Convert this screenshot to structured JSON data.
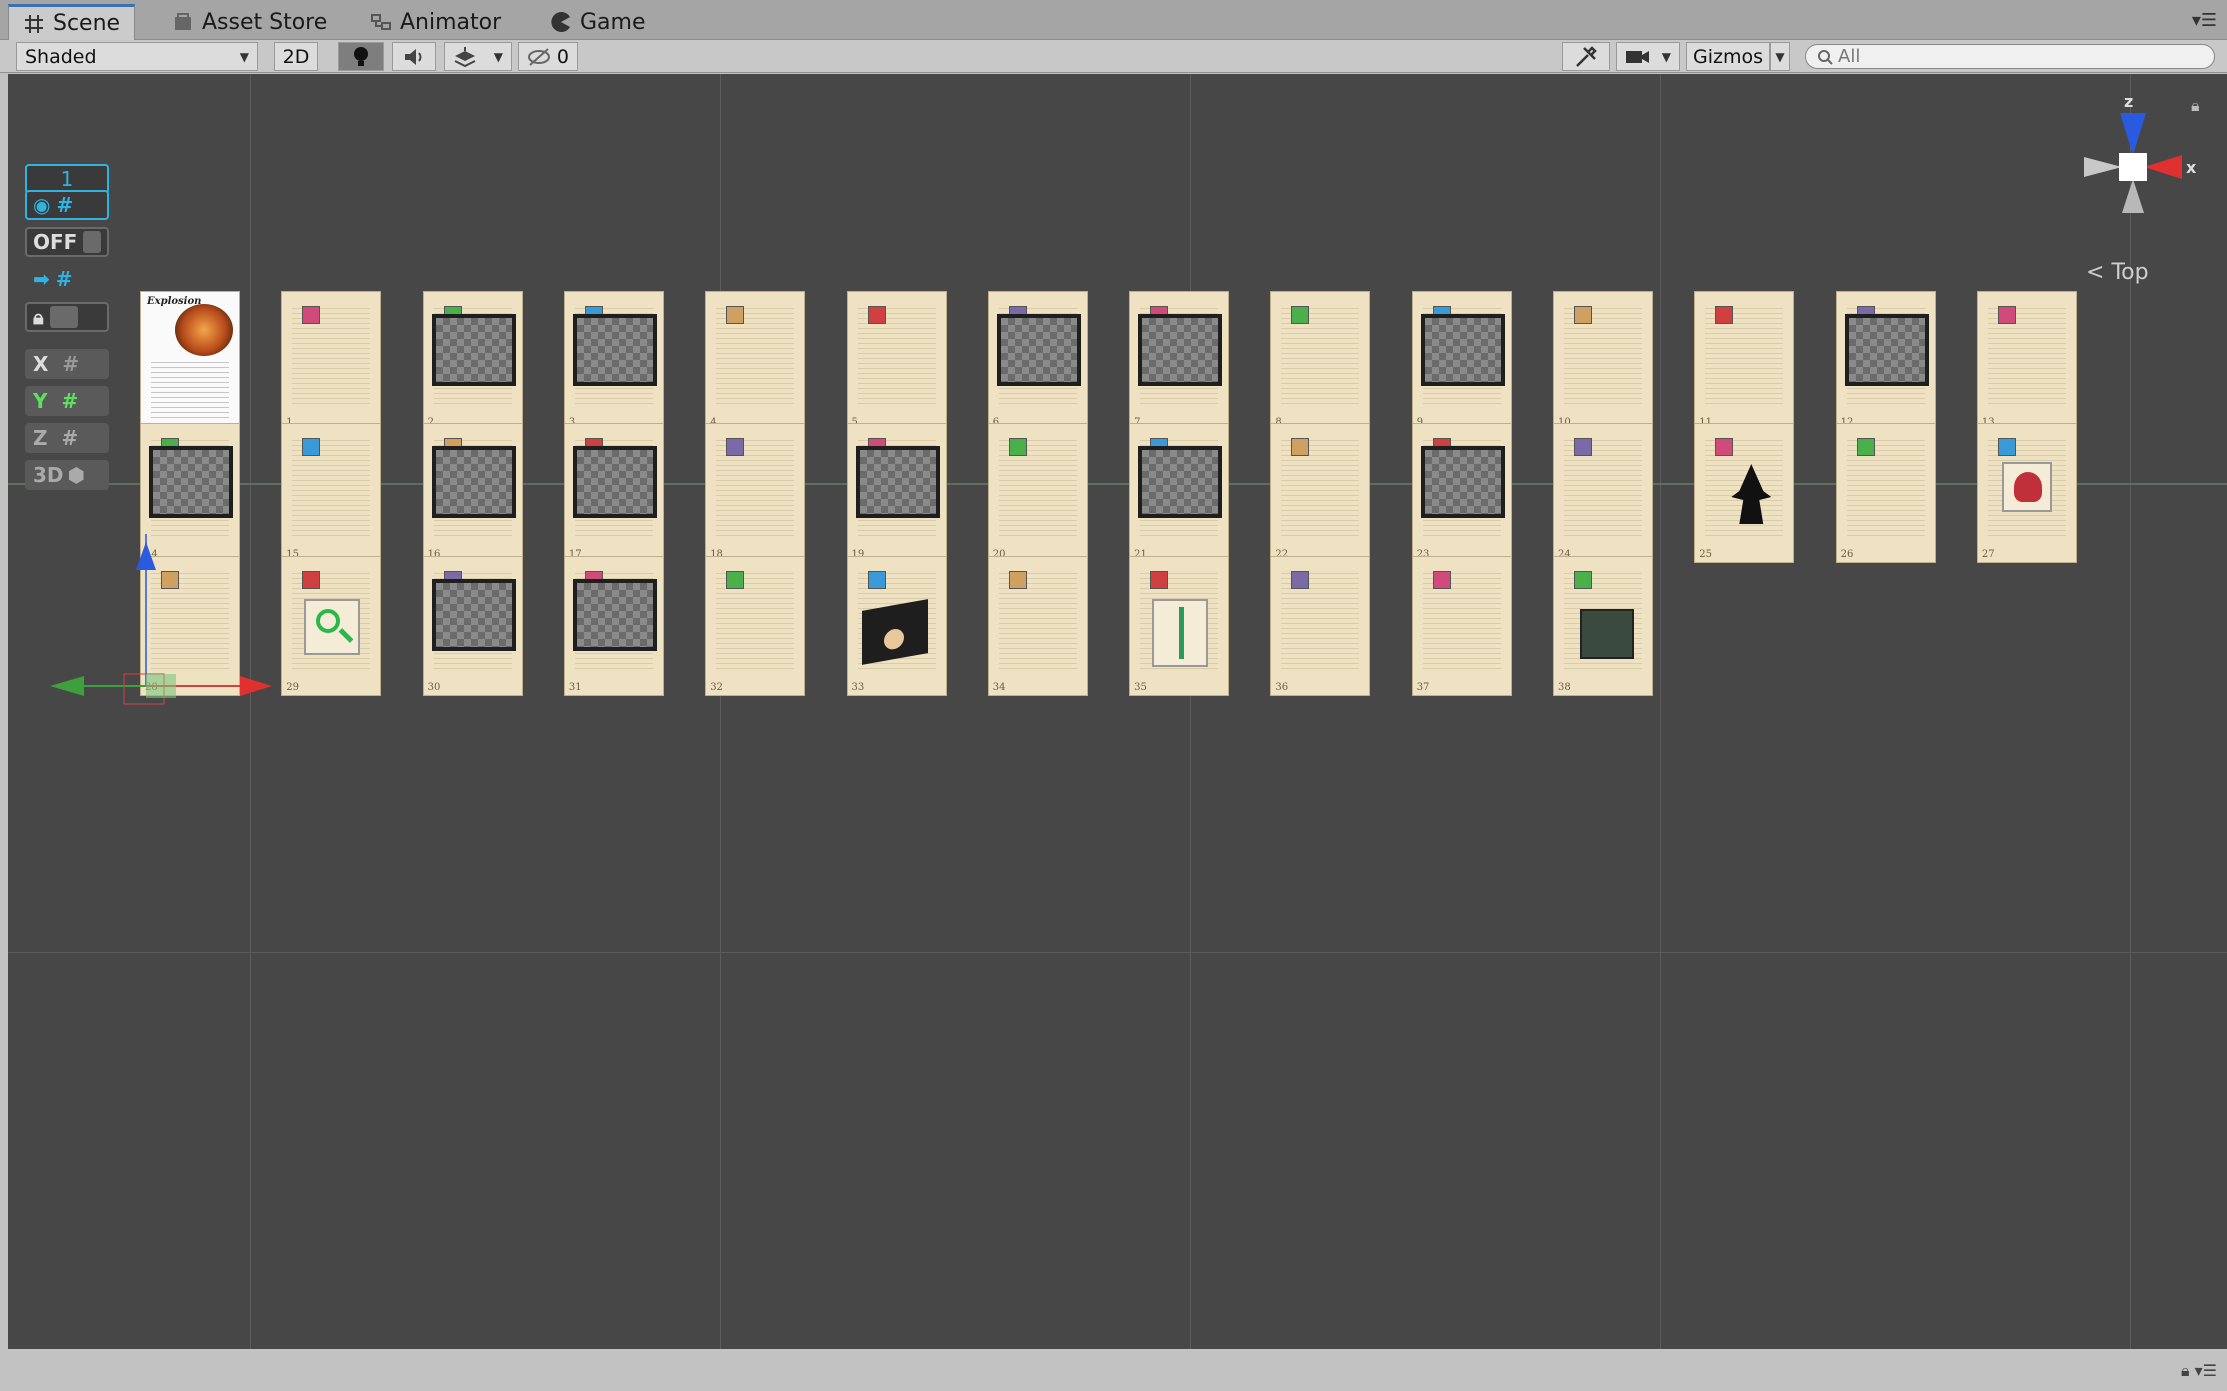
{
  "tabs": [
    {
      "label": "Scene",
      "icon": "grid-icon"
    },
    {
      "label": "Asset Store",
      "icon": "store-icon"
    },
    {
      "label": "Animator",
      "icon": "animator-icon"
    },
    {
      "label": "Game",
      "icon": "pacman-icon"
    }
  ],
  "toolbar": {
    "shading_mode": "Shaded",
    "mode_2d": "2D",
    "hidden_count": "0",
    "gizmos_label": "Gizmos",
    "search_placeholder": "All"
  },
  "overlay": {
    "layer_value": "1",
    "off_label": "OFF",
    "x_label": "X",
    "y_label": "Y",
    "z_label": "Z",
    "three_d_label": "3D"
  },
  "orientation": {
    "view_label": "Top",
    "z_axis": "z",
    "x_axis": "x"
  },
  "pages": [
    {
      "n": "",
      "kind": "explosion",
      "title": "Explosion"
    },
    {
      "n": "1",
      "kind": "text"
    },
    {
      "n": "2",
      "kind": "room"
    },
    {
      "n": "3",
      "kind": "room"
    },
    {
      "n": "4",
      "kind": "text"
    },
    {
      "n": "5",
      "kind": "text"
    },
    {
      "n": "6",
      "kind": "room"
    },
    {
      "n": "7",
      "kind": "room"
    },
    {
      "n": "8",
      "kind": "text"
    },
    {
      "n": "9",
      "kind": "room"
    },
    {
      "n": "10",
      "kind": "text"
    },
    {
      "n": "11",
      "kind": "text"
    },
    {
      "n": "12",
      "kind": "room"
    },
    {
      "n": "13",
      "kind": "text"
    },
    {
      "n": "14",
      "kind": "room"
    },
    {
      "n": "15",
      "kind": "text"
    },
    {
      "n": "16",
      "kind": "room"
    },
    {
      "n": "17",
      "kind": "room"
    },
    {
      "n": "18",
      "kind": "text"
    },
    {
      "n": "19",
      "kind": "room"
    },
    {
      "n": "20",
      "kind": "text"
    },
    {
      "n": "21",
      "kind": "room"
    },
    {
      "n": "22",
      "kind": "text"
    },
    {
      "n": "23",
      "kind": "room"
    },
    {
      "n": "24",
      "kind": "text"
    },
    {
      "n": "25",
      "kind": "witch"
    },
    {
      "n": "26",
      "kind": "text"
    },
    {
      "n": "27",
      "kind": "skull"
    },
    {
      "n": "28",
      "kind": "text"
    },
    {
      "n": "29",
      "kind": "magnifier"
    },
    {
      "n": "30",
      "kind": "room"
    },
    {
      "n": "31",
      "kind": "room"
    },
    {
      "n": "32",
      "kind": "text"
    },
    {
      "n": "33",
      "kind": "bag"
    },
    {
      "n": "34",
      "kind": "text"
    },
    {
      "n": "35",
      "kind": "sword"
    },
    {
      "n": "36",
      "kind": "text"
    },
    {
      "n": "37",
      "kind": "text"
    },
    {
      "n": "38",
      "kind": "book"
    }
  ]
}
